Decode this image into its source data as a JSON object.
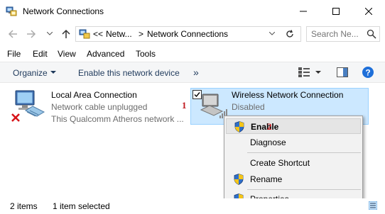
{
  "window": {
    "title": "Network Connections",
    "icon": "network-connections-icon",
    "controls": {
      "minimize": "minimize-icon",
      "maximize": "maximize-icon",
      "close": "close-icon"
    }
  },
  "address": {
    "crumb_overflow": "<<",
    "crumb_1": "Netw...",
    "separator": ">",
    "crumb_2": "Network Connections",
    "search_placeholder": "Search Ne..."
  },
  "menu": {
    "items": [
      "File",
      "Edit",
      "View",
      "Advanced",
      "Tools"
    ]
  },
  "toolbar": {
    "organize": "Organize",
    "enable_device": "Enable this network device",
    "more": "»"
  },
  "connections": [
    {
      "name": "Local Area Connection",
      "status": "Network cable unplugged",
      "device": "This Qualcomm Atheros network ..."
    },
    {
      "name": "Wireless Network Connection",
      "status": "Disabled"
    }
  ],
  "annotations": {
    "marker_1": "1",
    "marker_2": "2"
  },
  "context_menu": {
    "enable": "Enable",
    "diagnose": "Diagnose",
    "create_shortcut": "Create Shortcut",
    "rename": "Rename",
    "properties": "Properties"
  },
  "status_bar": {
    "count": "2 items",
    "selection": "1 item selected"
  },
  "colors": {
    "selection_bg": "#cce8ff",
    "selection_border": "#99d1ff",
    "toolbar_text": "#1e395b",
    "help_blue": "#1e6fd9",
    "marker_red": "#c0191e"
  }
}
